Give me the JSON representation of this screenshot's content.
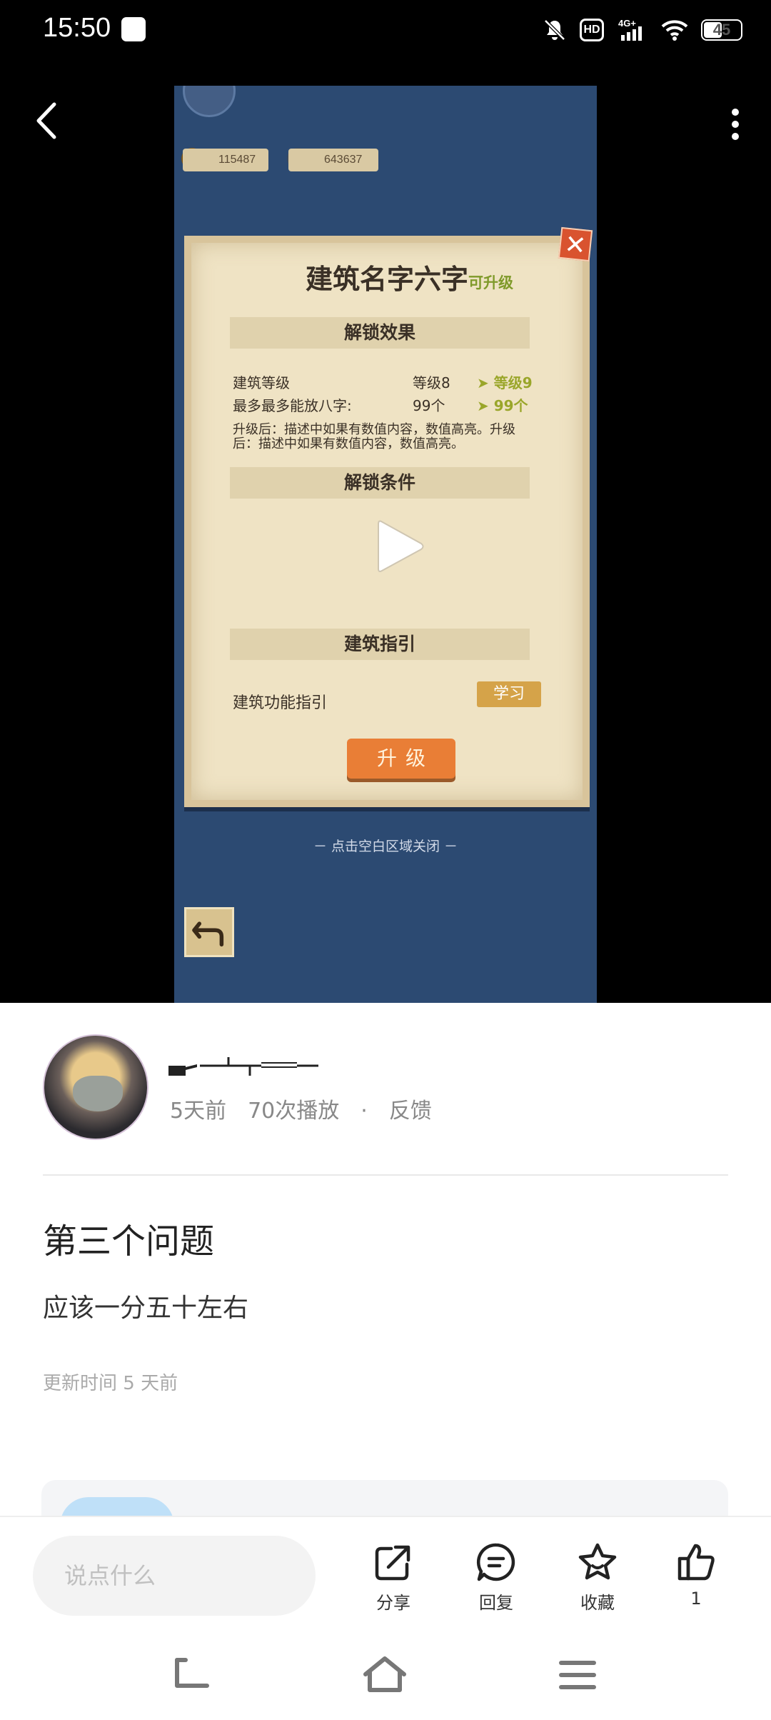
{
  "status_bar": {
    "time": "15:50",
    "network": "4G+",
    "battery": "45",
    "icons": [
      "message-icon",
      "mute-icon",
      "hd-icon",
      "signal-icon",
      "wifi-icon",
      "battery-icon"
    ]
  },
  "video": {
    "resources": [
      "115487",
      "643637"
    ],
    "building_title": "建筑名字六字",
    "upgradable_tag": "可升级",
    "section_unlock_effect": "解锁效果",
    "rows": [
      {
        "label": "建筑等级",
        "current": "等级8",
        "next": "➤ 等级9"
      },
      {
        "label": "最多最多能放八字:",
        "current": "99个",
        "next": "➤ 99个"
      }
    ],
    "description": "升级后：描述中如果有数值内容，数值高亮。升级后：描述中如果有数值内容，数值高亮。",
    "section_unlock_condition": "解锁条件",
    "section_guide": "建筑指引",
    "guide_label": "建筑功能指引",
    "learn_button": "学习",
    "upgrade_button": "升级",
    "close_hint": "－ 点击空白区域关闭 －",
    "close_mark": "✕"
  },
  "post": {
    "meta_time": "5天前",
    "meta_plays": "70次播放",
    "meta_dot": "·",
    "meta_feedback": "反馈",
    "title": "第三个问题",
    "body": "应该一分五十左右",
    "update_time": "更新时间 5 天前"
  },
  "action_bar": {
    "comment_placeholder": "说点什么",
    "share_label": "分享",
    "reply_label": "回复",
    "favorite_label": "收藏",
    "like_count": "1"
  },
  "colors": {
    "video_bg": "#2c4a72",
    "paper": "#efe3c4",
    "upgrade_button": "#e97e36",
    "highlight_green": "#9aa62a"
  }
}
